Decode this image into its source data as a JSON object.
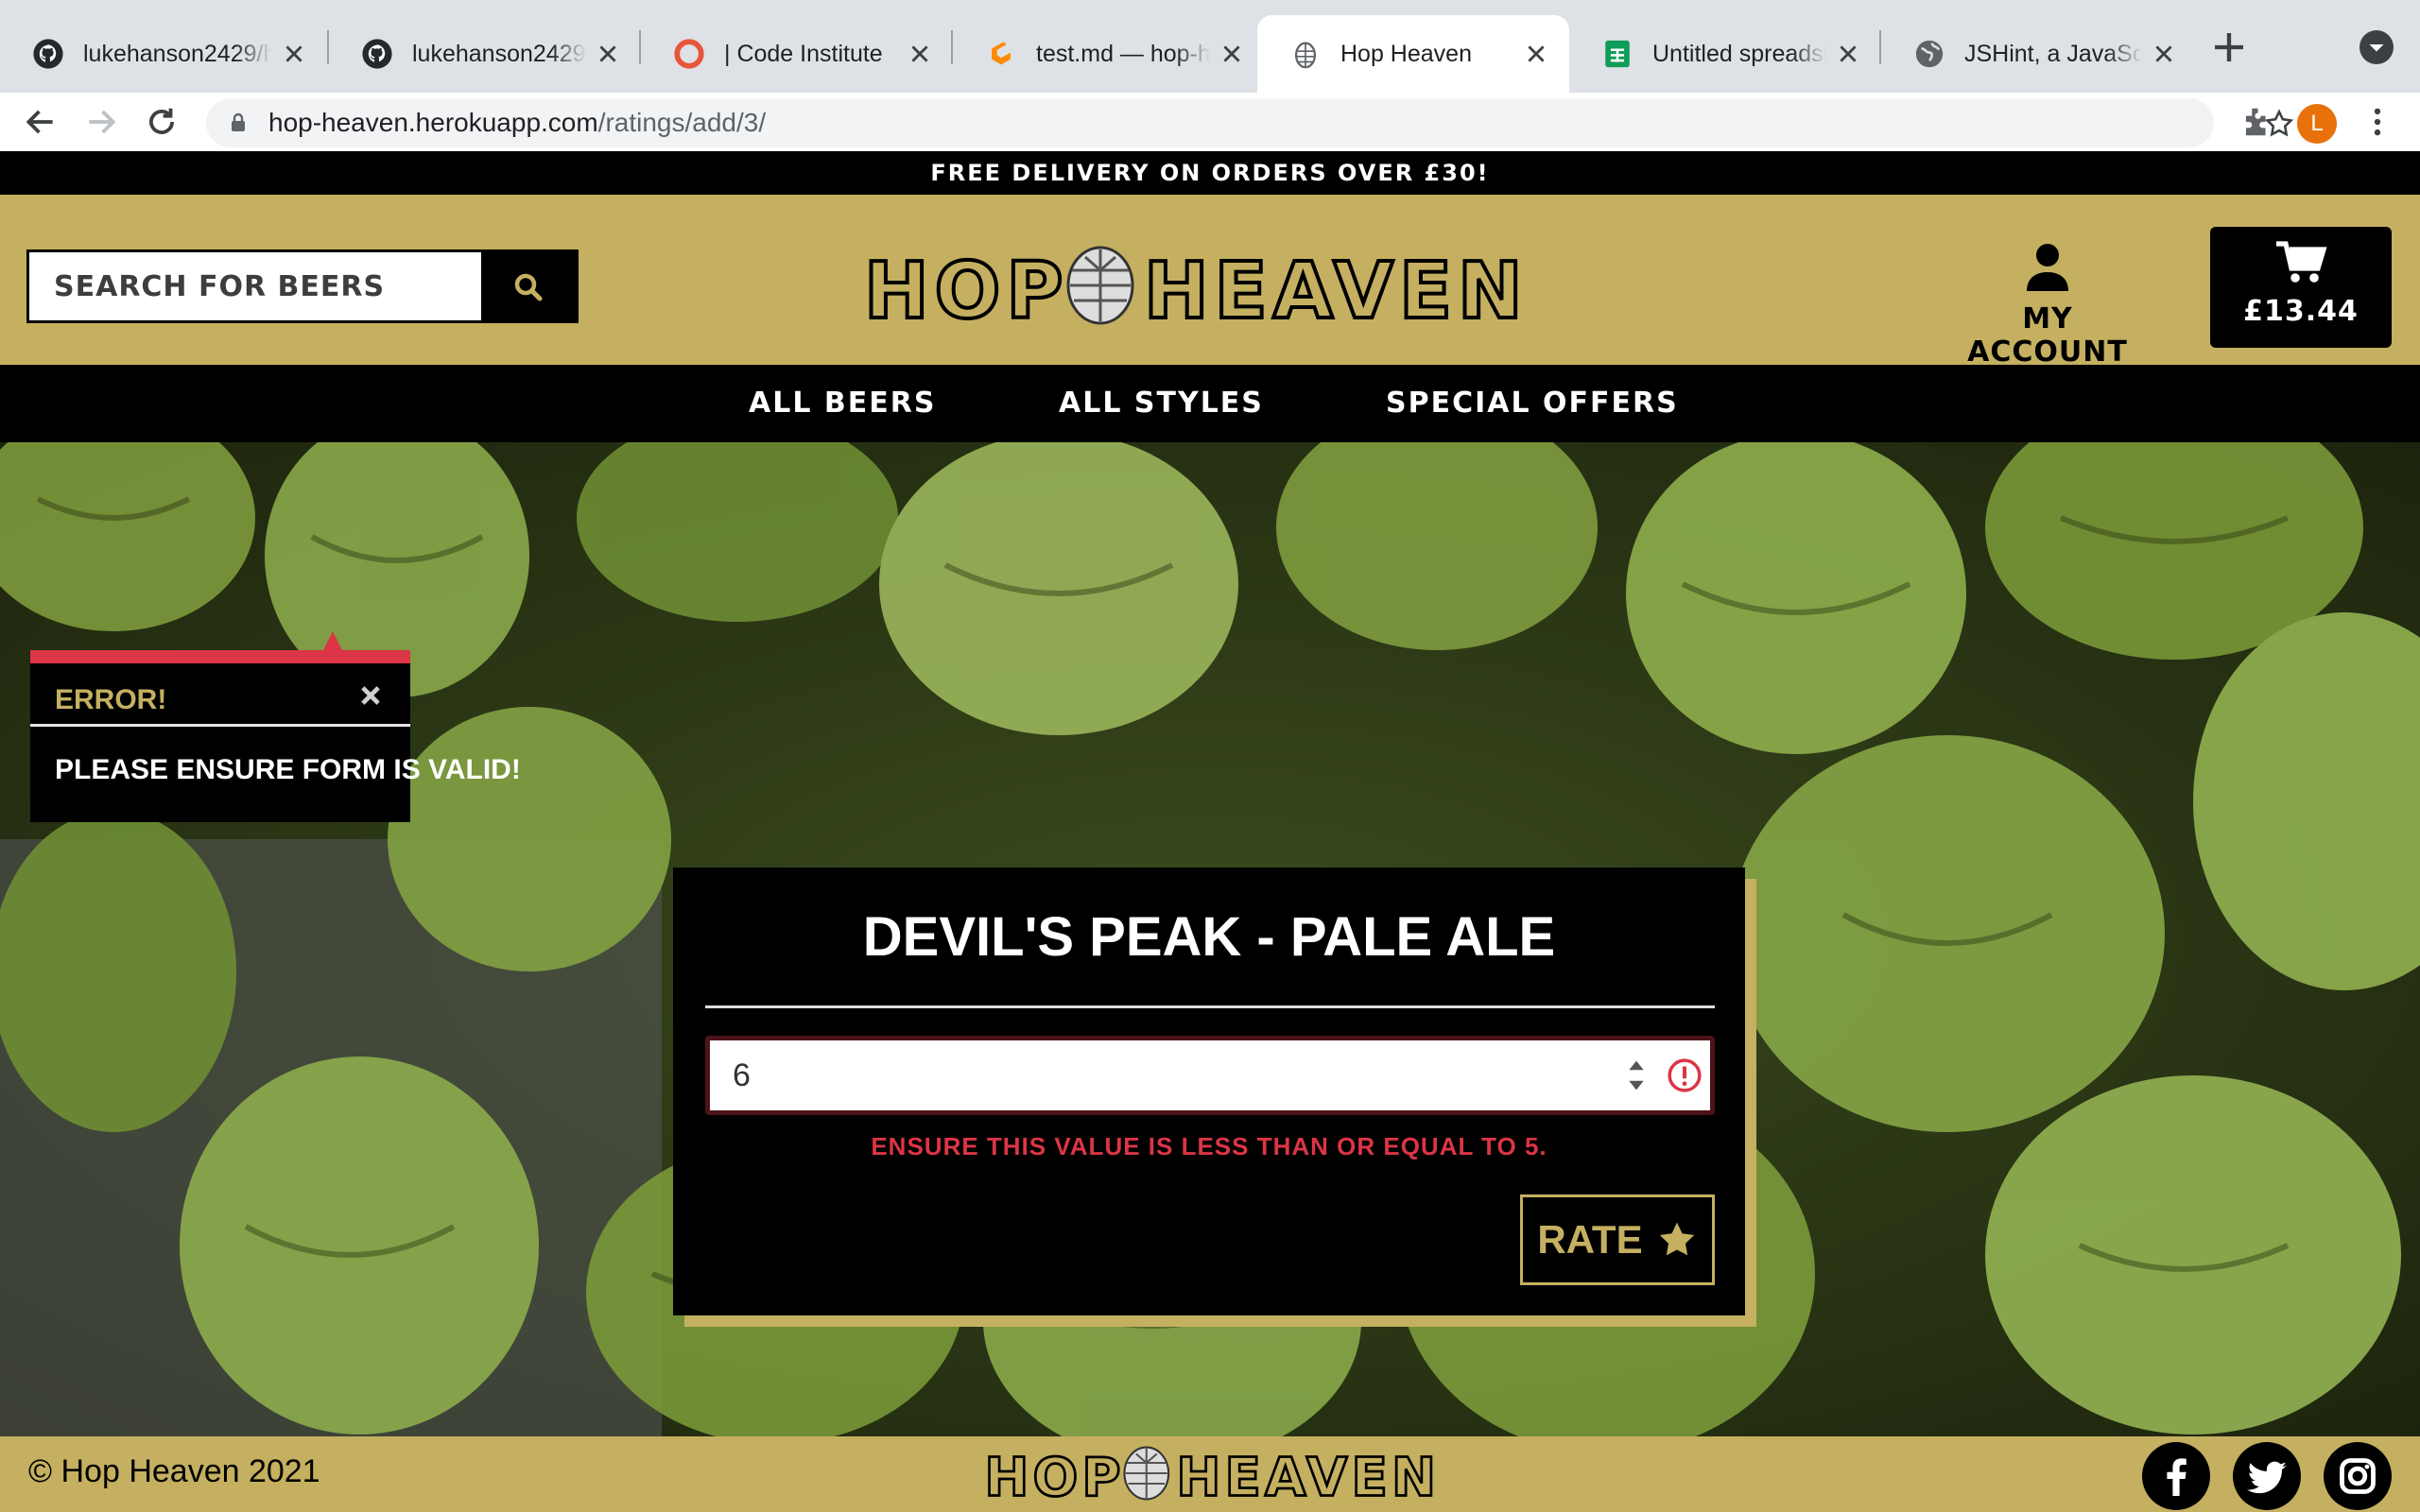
{
  "browser": {
    "tabs": [
      {
        "title": "lukehanson2429/h",
        "icon": "github-icon",
        "active": false
      },
      {
        "title": "lukehanson2429/h",
        "icon": "github-icon",
        "active": false
      },
      {
        "title": "| Code Institute",
        "icon": "code-institute-icon",
        "active": false
      },
      {
        "title": "test.md — hop-he",
        "icon": "gitpod-icon",
        "active": false
      },
      {
        "title": "Hop Heaven",
        "icon": "hop-icon",
        "active": true
      },
      {
        "title": "Untitled spreadsh",
        "icon": "sheets-icon",
        "active": false
      },
      {
        "title": "JSHint, a JavaScr",
        "icon": "globe-icon",
        "active": false
      }
    ],
    "url_host": "hop-heaven.herokuapp.com",
    "url_path": "/ratings/add/3/",
    "profile_initial": "L",
    "profile_color": "#e8710a"
  },
  "site": {
    "banner": "FREE DELIVERY ON ORDERS OVER £30!",
    "search_placeholder": "SEARCH FOR BEERS",
    "logo_left": "HOP",
    "logo_right": "HEAVEN",
    "account_label": "MY ACCOUNT",
    "cart_total": "£13.44",
    "nav": [
      "ALL BEERS",
      "ALL STYLES",
      "SPECIAL OFFERS"
    ],
    "toast": {
      "title": "ERROR!",
      "message": "PLEASE ENSURE FORM IS VALID!"
    },
    "form": {
      "beer_title": "DEVIL'S PEAK - PALE ALE",
      "rating_value": "6",
      "error": "ENSURE THIS VALUE IS LESS THAN OR EQUAL TO 5.",
      "submit_label": "RATE"
    },
    "footer": {
      "copyright": "© Hop Heaven 2021",
      "social": [
        "facebook-icon",
        "twitter-icon",
        "instagram-icon"
      ]
    }
  },
  "colors": {
    "brand_gold": "#c4b060",
    "error_red": "#dc3545",
    "black": "#000000"
  }
}
